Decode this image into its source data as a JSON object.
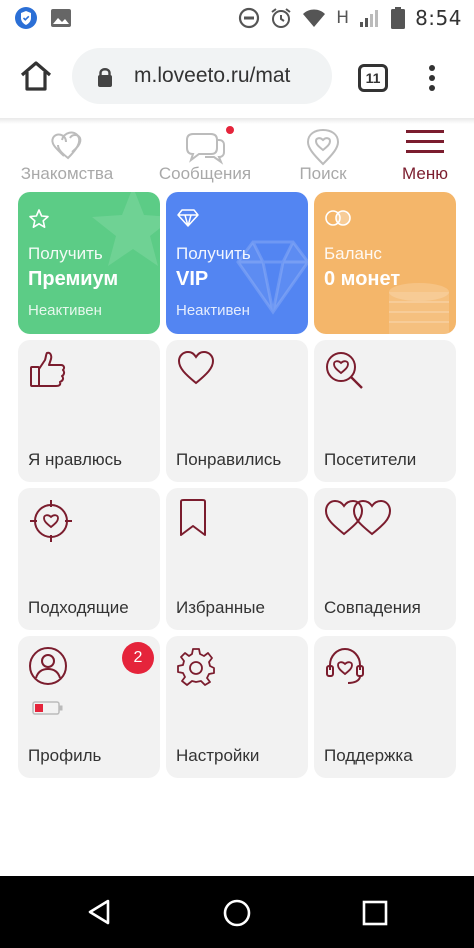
{
  "status_bar": {
    "time": "8:54",
    "network_letter": "H",
    "icons": [
      "shield-app-icon",
      "image-icon",
      "dnd-icon",
      "alarm-icon",
      "wifi-icon",
      "signal-icon",
      "battery-icon"
    ]
  },
  "browser": {
    "url": "m.loveeto.ru/mat",
    "tab_count": "11",
    "icons": [
      "home-icon",
      "lock-icon",
      "more-vert-icon"
    ]
  },
  "nav": {
    "items": [
      {
        "label": "Знакомства",
        "icon": "hearts-icon"
      },
      {
        "label": "Сообщения",
        "icon": "chat-bubbles-icon",
        "has_notification": true
      },
      {
        "label": "Поиск",
        "icon": "heart-pin-icon"
      },
      {
        "label": "Меню",
        "icon": "hamburger-icon",
        "active": true
      }
    ]
  },
  "promo": [
    {
      "line1": "Получить",
      "line2": "Премиум",
      "line3": "Неактивен",
      "icon": "star-icon",
      "color": "#5ccc86"
    },
    {
      "line1": "Получить",
      "line2": "VIP",
      "line3": "Неактивен",
      "icon": "diamond-icon",
      "color": "#5385f2"
    },
    {
      "line1": "Баланс",
      "line2": "0 монет",
      "line3": "",
      "icon": "coins-icon",
      "color": "#f4b66a"
    }
  ],
  "tiles": [
    {
      "label": "Я нравлюсь",
      "icon": "thumbs-up-icon"
    },
    {
      "label": "Понравились",
      "icon": "heart-icon"
    },
    {
      "label": "Посетители",
      "icon": "heart-magnifier-icon"
    },
    {
      "label": "Подходящие",
      "icon": "heart-target-icon"
    },
    {
      "label": "Избранные",
      "icon": "bookmark-icon"
    },
    {
      "label": "Совпадения",
      "icon": "double-heart-icon"
    },
    {
      "label": "Профиль",
      "icon": "user-icon",
      "badge": "2"
    },
    {
      "label": "Настройки",
      "icon": "gear-icon"
    },
    {
      "label": "Поддержка",
      "icon": "headset-icon"
    }
  ],
  "colors": {
    "accent": "#7b1d2e",
    "nav_inactive": "#a9a9a9",
    "tile_bg": "#f2f2f2",
    "badge": "#e5243b"
  }
}
